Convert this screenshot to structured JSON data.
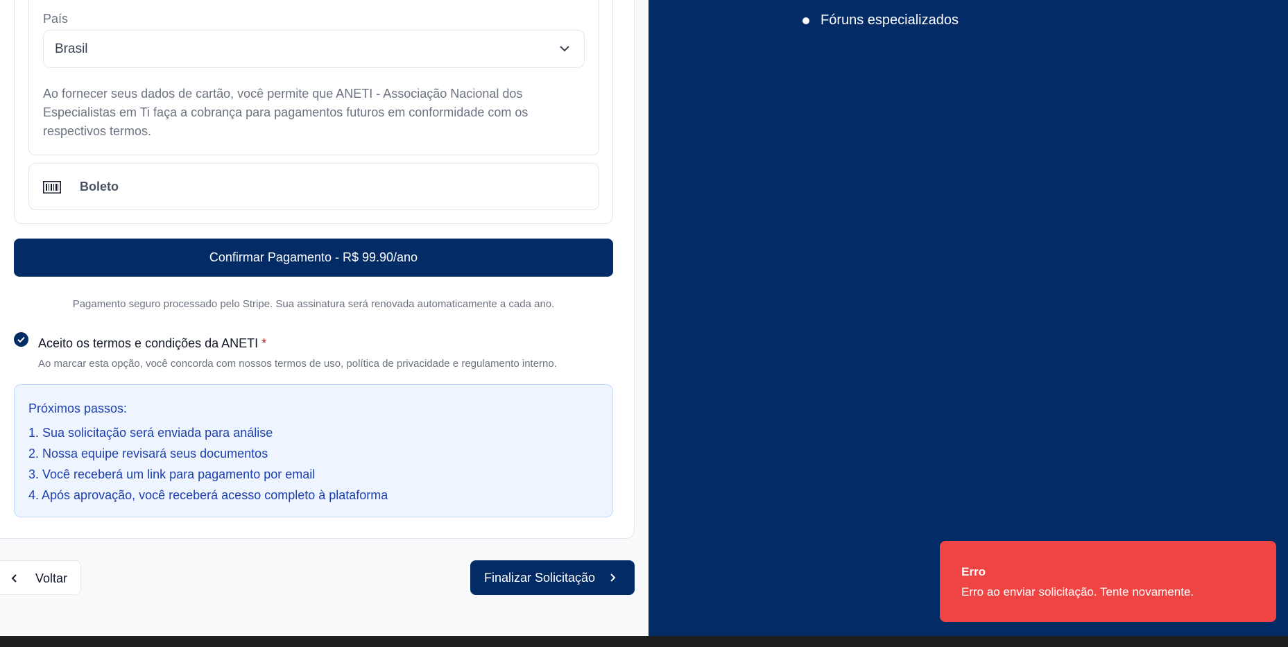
{
  "payment": {
    "country_label": "País",
    "country_value": "Brasil",
    "card_terms": "Ao fornecer seus dados de cartão, você permite que ANETI - Associação Nacional dos Especialistas em Ti faça a cobrança para pagamentos futuros em conformidade com os respectivos termos.",
    "boleto_label": "Boleto",
    "confirm_button": "Confirmar Pagamento - R$ 99.90/ano",
    "secure_text": "Pagamento seguro processado pelo Stripe. Sua assinatura será renovada automaticamente a cada ano."
  },
  "terms": {
    "checked": true,
    "label": "Aceito os termos e condições da ANETI",
    "required_mark": "*",
    "description": "Ao marcar esta opção, você concorda com nossos termos de uso, política de privacidade e regulamento interno."
  },
  "next_steps": {
    "title": "Próximos passos:",
    "items": [
      "1. Sua solicitação será enviada para análise",
      "2. Nossa equipe revisará seus documentos",
      "3. Você receberá um link para pagamento por email",
      "4. Após aprovação, você receberá acesso completo à plataforma"
    ]
  },
  "navigation": {
    "back_label": "Voltar",
    "finish_label": "Finalizar Solicitação"
  },
  "sidebar": {
    "benefits": [
      "Fóruns especializados"
    ]
  },
  "toast": {
    "title": "Erro",
    "message": "Erro ao enviar solicitação. Tente novamente."
  },
  "colors": {
    "brand": "#032b66",
    "error": "#ef4444",
    "info_bg": "#eef5ff",
    "info_text": "#1e40af"
  }
}
